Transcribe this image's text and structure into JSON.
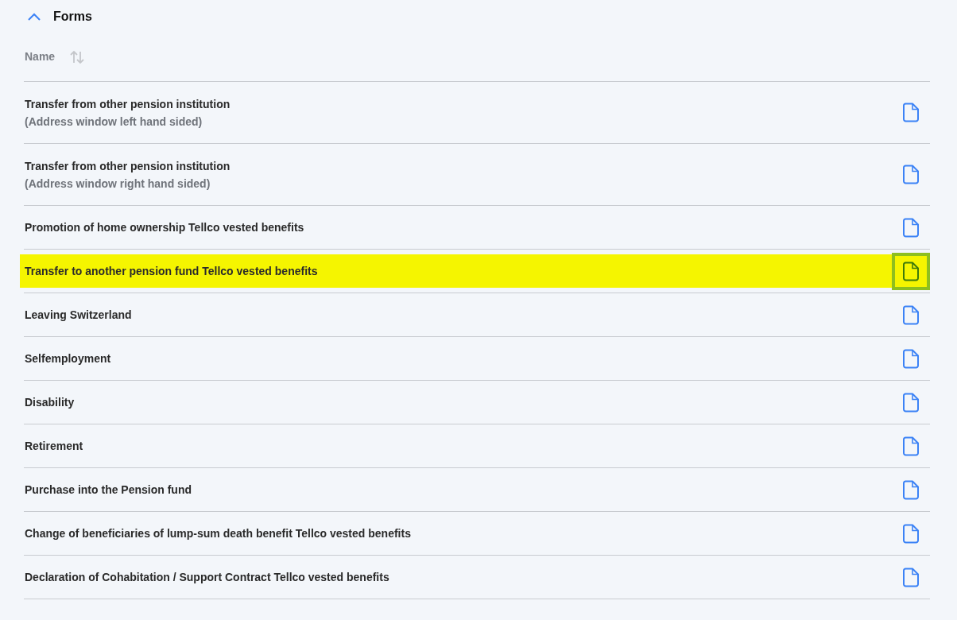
{
  "section": {
    "title": "Forms",
    "expanded": true
  },
  "columns": [
    {
      "label": "Name"
    }
  ],
  "rows": [
    {
      "title": "Transfer from other pension institution",
      "subtitle": "(Address window left hand sided)",
      "highlighted": false
    },
    {
      "title": "Transfer from other pension institution",
      "subtitle": "(Address window right hand sided)",
      "highlighted": false
    },
    {
      "title": "Promotion of home ownership Tellco vested benefits",
      "highlighted": false
    },
    {
      "title": "Transfer to another pension fund Tellco vested benefits",
      "highlighted": true
    },
    {
      "title": "Leaving Switzerland",
      "highlighted": false
    },
    {
      "title": "Selfemployment",
      "highlighted": false
    },
    {
      "title": "Disability",
      "highlighted": false
    },
    {
      "title": "Retirement",
      "highlighted": false
    },
    {
      "title": "Purchase into the Pension fund",
      "highlighted": false
    },
    {
      "title": "Change of beneficiaries of lump-sum death benefit Tellco vested benefits",
      "highlighted": false
    },
    {
      "title": "Declaration of Cohabitation / Support Contract Tellco vested benefits",
      "highlighted": false
    }
  ]
}
